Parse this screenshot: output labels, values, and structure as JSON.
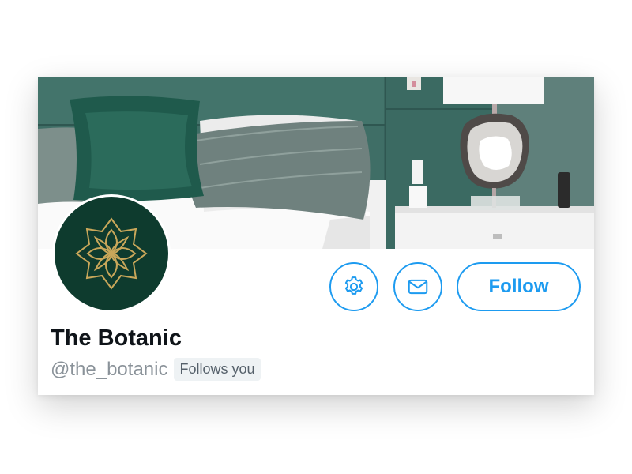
{
  "profile": {
    "display_name": "The Botanic",
    "handle": "@the_botanic",
    "follows_you_label": "Follows you"
  },
  "actions": {
    "settings_icon": "gear-icon",
    "message_icon": "envelope-icon",
    "follow_label": "Follow"
  },
  "banner": {
    "description_icon": "bedroom-photo"
  },
  "avatar": {
    "icon": "lotus-logo"
  },
  "colors": {
    "accent": "#1d9bf0",
    "avatar_bg": "#0e3b2e",
    "logo_gold": "#c9a75a",
    "handle_gray": "#8a9299",
    "badge_bg": "#eef2f4"
  }
}
